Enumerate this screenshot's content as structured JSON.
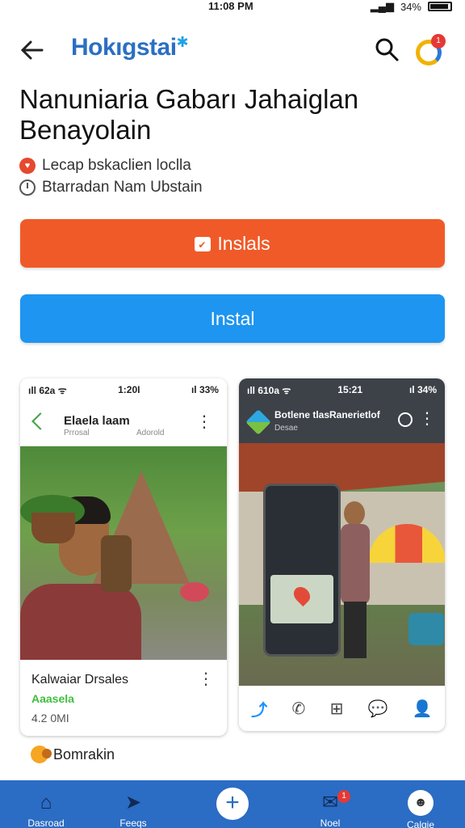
{
  "status_bar": {
    "time": "11:08 PM",
    "battery": "34%"
  },
  "app_bar": {
    "brand": "Hokıgstai",
    "brand_mark": "✱",
    "notification_count": "1"
  },
  "title": "Nanuniaria Gabarı Jahaiglan Benayolain",
  "meta": {
    "line1": "Lecap bskaclien loclla",
    "line2": "Btarradan Nam Ubstain"
  },
  "buttons": {
    "primary": "Inslals",
    "secondary": "Instal"
  },
  "card_left": {
    "status": {
      "left": "ıll 62a ᯤ",
      "center": "1:20I",
      "right": "ıl 33%"
    },
    "header_title": "Elaela laam",
    "header_sub1": "Prrosal",
    "header_sub2": "Adorold",
    "body_title": "Kalwaiar Drsales",
    "body_tag": "Aaasela",
    "body_size": "4.2 0MI"
  },
  "card_right": {
    "status": {
      "left": "ıll 610a ᯤ",
      "center": "15:21",
      "right": "ıl 34%"
    },
    "header_title": "Botlene tlasRanerietlof",
    "header_sub": "Desae"
  },
  "bookmark": {
    "label": "Bomrakin"
  },
  "bottom_nav": {
    "home": "Dasroad",
    "feeds": "Feeqs",
    "mail": "Noel",
    "mail_badge": "1",
    "profile": "Calgie"
  }
}
